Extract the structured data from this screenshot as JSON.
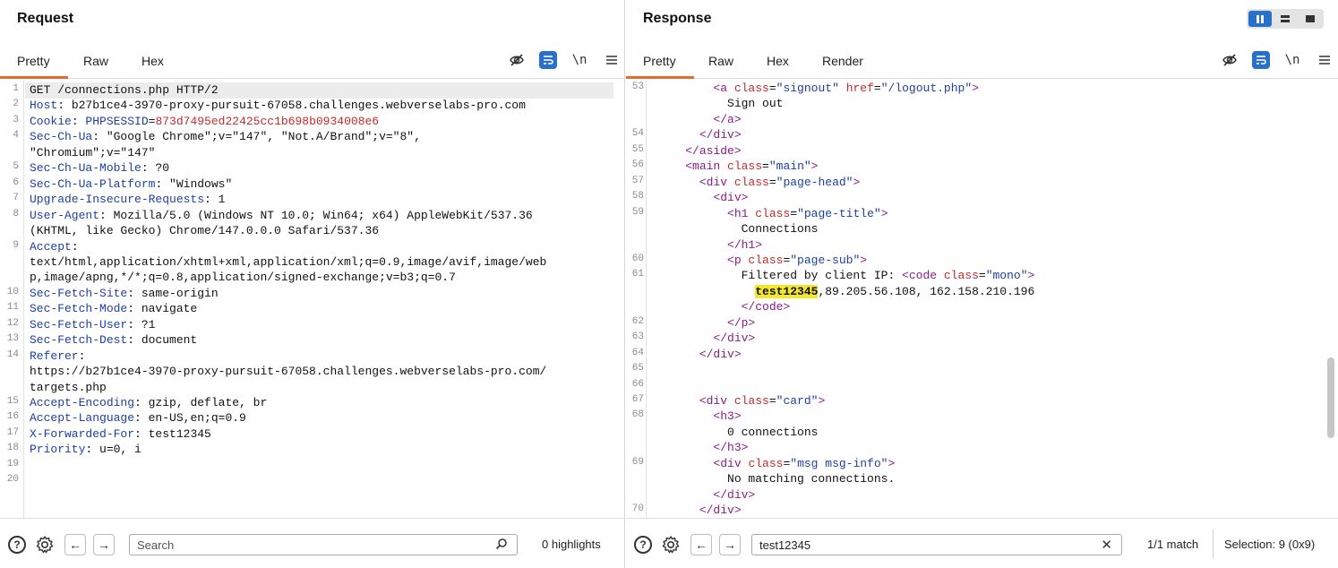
{
  "request": {
    "title": "Request",
    "tabs": [
      "Pretty",
      "Raw",
      "Hex"
    ],
    "active_tab": "Pretty",
    "lines": [
      {
        "n": "1",
        "parts": [
          [
            "",
            "GET /connections.php HTTP/2"
          ]
        ]
      },
      {
        "n": "2",
        "parts": [
          [
            "k",
            "Host"
          ],
          [
            "",
            ": b27b1ce4-3970-proxy-pursuit-67058.challenges.webverselabs-pro.com"
          ]
        ]
      },
      {
        "n": "3",
        "parts": [
          [
            "k",
            "Cookie"
          ],
          [
            "",
            ": "
          ],
          [
            "k",
            "PHPSESSID"
          ],
          [
            "",
            "="
          ],
          [
            "v",
            "873d7495ed22425cc1b698b0934008e6"
          ]
        ]
      },
      {
        "n": "4",
        "parts": [
          [
            "k",
            "Sec-Ch-Ua"
          ],
          [
            "",
            ": \"Google Chrome\";v=\"147\", \"Not.A/Brand\";v=\"8\","
          ]
        ]
      },
      {
        "n": "",
        "parts": [
          [
            "",
            "\"Chromium\";v=\"147\""
          ]
        ]
      },
      {
        "n": "5",
        "parts": [
          [
            "k",
            "Sec-Ch-Ua-Mobile"
          ],
          [
            "",
            ": ?0"
          ]
        ]
      },
      {
        "n": "6",
        "parts": [
          [
            "k",
            "Sec-Ch-Ua-Platform"
          ],
          [
            "",
            ": \"Windows\""
          ]
        ]
      },
      {
        "n": "7",
        "parts": [
          [
            "k",
            "Upgrade-Insecure-Requests"
          ],
          [
            "",
            ": 1"
          ]
        ]
      },
      {
        "n": "8",
        "parts": [
          [
            "k",
            "User-Agent"
          ],
          [
            "",
            ": Mozilla/5.0 (Windows NT 10.0; Win64; x64) AppleWebKit/537.36"
          ]
        ]
      },
      {
        "n": "",
        "parts": [
          [
            "",
            "(KHTML, like Gecko) Chrome/147.0.0.0 Safari/537.36"
          ]
        ]
      },
      {
        "n": "9",
        "parts": [
          [
            "k",
            "Accept"
          ],
          [
            "",
            ":"
          ]
        ]
      },
      {
        "n": "",
        "parts": [
          [
            "",
            "text/html,application/xhtml+xml,application/xml;q=0.9,image/avif,image/web"
          ]
        ]
      },
      {
        "n": "",
        "parts": [
          [
            "",
            "p,image/apng,*/*;q=0.8,application/signed-exchange;v=b3;q=0.7"
          ]
        ]
      },
      {
        "n": "10",
        "parts": [
          [
            "k",
            "Sec-Fetch-Site"
          ],
          [
            "",
            ": same-origin"
          ]
        ]
      },
      {
        "n": "11",
        "parts": [
          [
            "k",
            "Sec-Fetch-Mode"
          ],
          [
            "",
            ": navigate"
          ]
        ]
      },
      {
        "n": "12",
        "parts": [
          [
            "k",
            "Sec-Fetch-User"
          ],
          [
            "",
            ": ?1"
          ]
        ]
      },
      {
        "n": "13",
        "parts": [
          [
            "k",
            "Sec-Fetch-Dest"
          ],
          [
            "",
            ": document"
          ]
        ]
      },
      {
        "n": "14",
        "parts": [
          [
            "k",
            "Referer"
          ],
          [
            "",
            ":"
          ]
        ]
      },
      {
        "n": "",
        "parts": [
          [
            "",
            "https://b27b1ce4-3970-proxy-pursuit-67058.challenges.webverselabs-pro.com/"
          ]
        ]
      },
      {
        "n": "",
        "parts": [
          [
            "",
            "targets.php"
          ]
        ]
      },
      {
        "n": "15",
        "parts": [
          [
            "k",
            "Accept-Encoding"
          ],
          [
            "",
            ": gzip, deflate, br"
          ]
        ]
      },
      {
        "n": "16",
        "parts": [
          [
            "k",
            "Accept-Language"
          ],
          [
            "",
            ": en-US,en;q=0.9"
          ]
        ]
      },
      {
        "n": "17",
        "parts": [
          [
            "k",
            "X-Forwarded-For"
          ],
          [
            "",
            ": test12345"
          ]
        ]
      },
      {
        "n": "18",
        "parts": [
          [
            "k",
            "Priority"
          ],
          [
            "",
            ": u=0, i"
          ]
        ]
      },
      {
        "n": "19",
        "parts": [
          [
            "",
            ""
          ]
        ]
      },
      {
        "n": "20",
        "parts": [
          [
            "",
            ""
          ]
        ]
      }
    ],
    "search_placeholder": "Search",
    "highlights_text": "0 highlights"
  },
  "response": {
    "title": "Response",
    "tabs": [
      "Pretty",
      "Raw",
      "Hex",
      "Render"
    ],
    "active_tab": "Pretty",
    "lines": [
      {
        "n": "53",
        "parts": [
          [
            "",
            "        "
          ],
          [
            "tag",
            "<a "
          ],
          [
            "attr",
            "class"
          ],
          [
            "",
            "="
          ],
          [
            "str",
            "\"signout\""
          ],
          [
            "",
            " "
          ],
          [
            "attr",
            "href"
          ],
          [
            "",
            "="
          ],
          [
            "str",
            "\"/logout.php\""
          ],
          [
            "tag",
            ">"
          ]
        ]
      },
      {
        "n": "",
        "parts": [
          [
            "",
            "          Sign out"
          ]
        ]
      },
      {
        "n": "",
        "parts": [
          [
            "",
            "        "
          ],
          [
            "tag",
            "</a>"
          ]
        ]
      },
      {
        "n": "54",
        "parts": [
          [
            "",
            "      "
          ],
          [
            "tag",
            "</div>"
          ]
        ]
      },
      {
        "n": "55",
        "parts": [
          [
            "",
            "    "
          ],
          [
            "tag",
            "</aside>"
          ]
        ]
      },
      {
        "n": "56",
        "parts": [
          [
            "",
            "    "
          ],
          [
            "tag",
            "<main "
          ],
          [
            "attr",
            "class"
          ],
          [
            "",
            "="
          ],
          [
            "str",
            "\"main\""
          ],
          [
            "tag",
            ">"
          ]
        ]
      },
      {
        "n": "57",
        "parts": [
          [
            "",
            "      "
          ],
          [
            "tag",
            "<div "
          ],
          [
            "attr",
            "class"
          ],
          [
            "",
            "="
          ],
          [
            "str",
            "\"page-head\""
          ],
          [
            "tag",
            ">"
          ]
        ]
      },
      {
        "n": "58",
        "parts": [
          [
            "",
            "        "
          ],
          [
            "tag",
            "<div>"
          ]
        ]
      },
      {
        "n": "59",
        "parts": [
          [
            "",
            "          "
          ],
          [
            "tag",
            "<h1 "
          ],
          [
            "attr",
            "class"
          ],
          [
            "",
            "="
          ],
          [
            "str",
            "\"page-title\""
          ],
          [
            "tag",
            ">"
          ]
        ]
      },
      {
        "n": "",
        "parts": [
          [
            "",
            "            Connections"
          ]
        ]
      },
      {
        "n": "",
        "parts": [
          [
            "",
            "          "
          ],
          [
            "tag",
            "</h1>"
          ]
        ]
      },
      {
        "n": "60",
        "parts": [
          [
            "",
            "          "
          ],
          [
            "tag",
            "<p "
          ],
          [
            "attr",
            "class"
          ],
          [
            "",
            "="
          ],
          [
            "str",
            "\"page-sub\""
          ],
          [
            "tag",
            ">"
          ]
        ]
      },
      {
        "n": "61",
        "parts": [
          [
            "",
            "            Filtered by client IP: "
          ],
          [
            "tag",
            "<code "
          ],
          [
            "attr",
            "class"
          ],
          [
            "",
            "="
          ],
          [
            "str",
            "\"mono\""
          ],
          [
            "tag",
            ">"
          ]
        ]
      },
      {
        "n": "",
        "parts": [
          [
            "",
            "              "
          ],
          [
            "match",
            "test12345"
          ],
          [
            "",
            ",89.205.56.108, 162.158.210.196"
          ]
        ]
      },
      {
        "n": "",
        "parts": [
          [
            "",
            "            "
          ],
          [
            "tag",
            "</code>"
          ]
        ]
      },
      {
        "n": "62",
        "parts": [
          [
            "",
            "          "
          ],
          [
            "tag",
            "</p>"
          ]
        ]
      },
      {
        "n": "63",
        "parts": [
          [
            "",
            "        "
          ],
          [
            "tag",
            "</div>"
          ]
        ]
      },
      {
        "n": "64",
        "parts": [
          [
            "",
            "      "
          ],
          [
            "tag",
            "</div>"
          ]
        ]
      },
      {
        "n": "65",
        "parts": [
          [
            "",
            ""
          ]
        ]
      },
      {
        "n": "66",
        "parts": [
          [
            "",
            ""
          ]
        ]
      },
      {
        "n": "67",
        "parts": [
          [
            "",
            "      "
          ],
          [
            "tag",
            "<div "
          ],
          [
            "attr",
            "class"
          ],
          [
            "",
            "="
          ],
          [
            "str",
            "\"card\""
          ],
          [
            "tag",
            ">"
          ]
        ]
      },
      {
        "n": "68",
        "parts": [
          [
            "",
            "        "
          ],
          [
            "tag",
            "<h3>"
          ]
        ]
      },
      {
        "n": "",
        "parts": [
          [
            "",
            "          0 connections"
          ]
        ]
      },
      {
        "n": "",
        "parts": [
          [
            "",
            "        "
          ],
          [
            "tag",
            "</h3>"
          ]
        ]
      },
      {
        "n": "69",
        "parts": [
          [
            "",
            "        "
          ],
          [
            "tag",
            "<div "
          ],
          [
            "attr",
            "class"
          ],
          [
            "",
            "="
          ],
          [
            "str",
            "\"msg msg-info\""
          ],
          [
            "tag",
            ">"
          ]
        ]
      },
      {
        "n": "",
        "parts": [
          [
            "",
            "          No matching connections."
          ]
        ]
      },
      {
        "n": "",
        "parts": [
          [
            "",
            "        "
          ],
          [
            "tag",
            "</div>"
          ]
        ]
      },
      {
        "n": "70",
        "parts": [
          [
            "",
            "      "
          ],
          [
            "tag",
            "</div>"
          ]
        ]
      }
    ],
    "search_value": "test12345",
    "match_text": "1/1 match",
    "selection_text": "Selection: 9 (0x9)"
  },
  "icons": {
    "hide": "eye-slash-icon",
    "wrap": "wrap-lines-icon",
    "newline": "newline-icon",
    "menu": "hamburger-menu-icon",
    "help": "help-icon",
    "settings": "gear-icon",
    "back": "arrow-left-icon",
    "forward": "arrow-right-icon",
    "search": "magnifier-icon",
    "clear": "close-icon"
  },
  "colors": {
    "accent_tab": "#e8692c",
    "primary_blue": "#2870c8",
    "match_highlight": "#f5e82a"
  }
}
